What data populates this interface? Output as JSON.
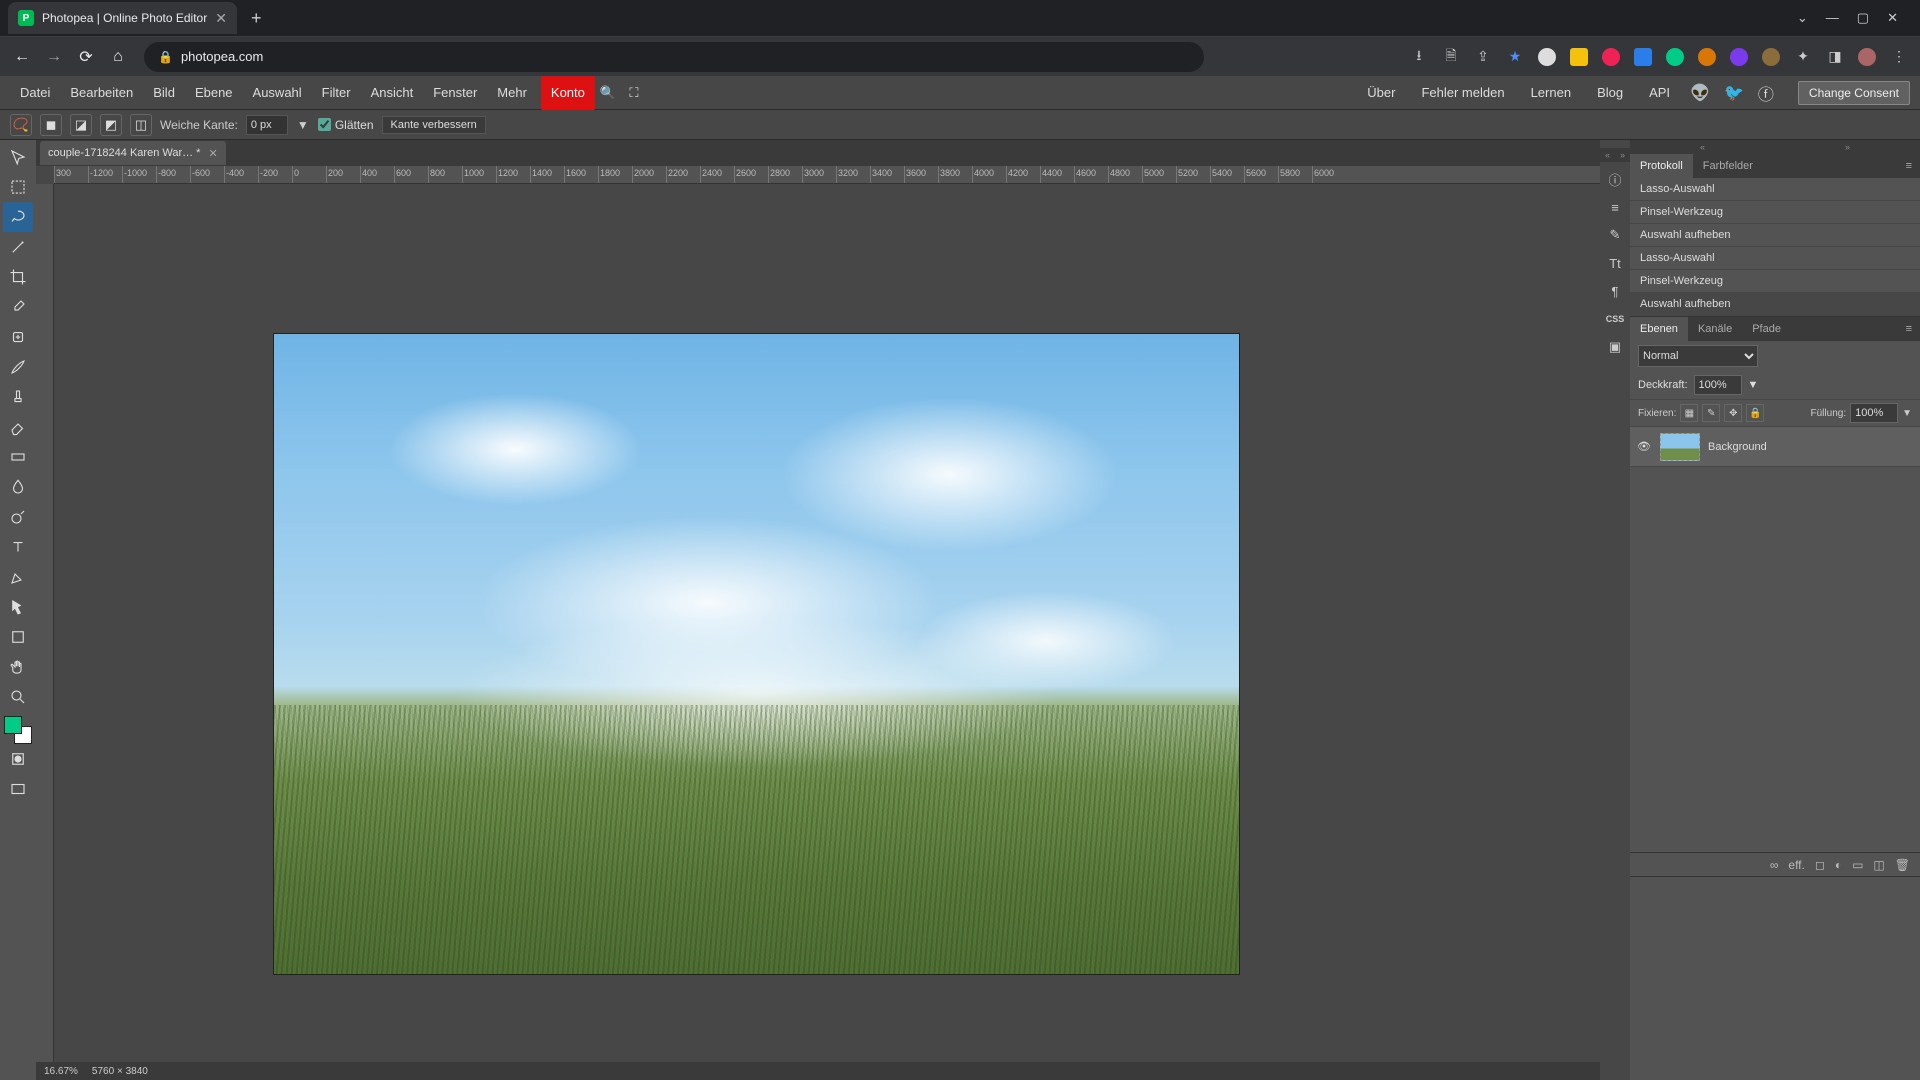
{
  "browser": {
    "tab_title": "Photopea | Online Photo Editor",
    "url": "photopea.com",
    "window": {
      "min": "—",
      "max": "▢",
      "close": "✕",
      "dropdown": "⌄"
    }
  },
  "top_menu": {
    "items": [
      "Datei",
      "Bearbeiten",
      "Bild",
      "Ebene",
      "Auswahl",
      "Filter",
      "Ansicht",
      "Fenster",
      "Mehr"
    ],
    "konto": "Konto",
    "right": [
      "Über",
      "Fehler melden",
      "Lernen",
      "Blog",
      "API"
    ],
    "consent": "Change Consent"
  },
  "options_bar": {
    "feather_label": "Weiche Kante:",
    "feather_value": "0 px",
    "antialias_label": "Glätten",
    "antialias_checked": true,
    "refine_label": "Kante verbessern"
  },
  "document": {
    "tab_name": "couple-1718244 Karen War… *",
    "zoom": "16.67%",
    "dims": "5760 × 3840"
  },
  "ruler_h": [
    "300",
    "-1200",
    "-1000",
    "-800",
    "-600",
    "-400",
    "-200",
    "0",
    "200",
    "400",
    "600",
    "800",
    "1000",
    "1200",
    "1400",
    "1600",
    "1800",
    "2000",
    "2200",
    "2400",
    "2600",
    "2800",
    "3000",
    "3200",
    "3400",
    "3600",
    "3800",
    "4000",
    "4200",
    "4400",
    "4600",
    "4800",
    "5000",
    "5200",
    "5400",
    "5600",
    "5800",
    "6000"
  ],
  "history_panel": {
    "tabs": [
      "Protokoll",
      "Farbfelder"
    ],
    "active_tab": 0,
    "items": [
      "Lasso-Auswahl",
      "Pinsel-Werkzeug",
      "Auswahl aufheben",
      "Lasso-Auswahl",
      "Pinsel-Werkzeug",
      "Auswahl aufheben"
    ],
    "selected": 5
  },
  "layers_panel": {
    "tabs": [
      "Ebenen",
      "Kanäle",
      "Pfade"
    ],
    "active_tab": 0,
    "blend_mode": "Normal",
    "opacity_label": "Deckkraft:",
    "opacity_value": "100%",
    "lock_label": "Fixieren:",
    "fill_label": "Füllung:",
    "fill_value": "100%",
    "layers": [
      {
        "name": "Background",
        "visible": true
      }
    ],
    "footer_icons": [
      "∞",
      "eff.",
      "◻",
      "◐",
      "▭",
      "◫",
      "🗑"
    ]
  },
  "dock_icons": [
    "ⓘ",
    "≡",
    "✎",
    "Tt",
    "¶",
    "CSS",
    "▣"
  ]
}
